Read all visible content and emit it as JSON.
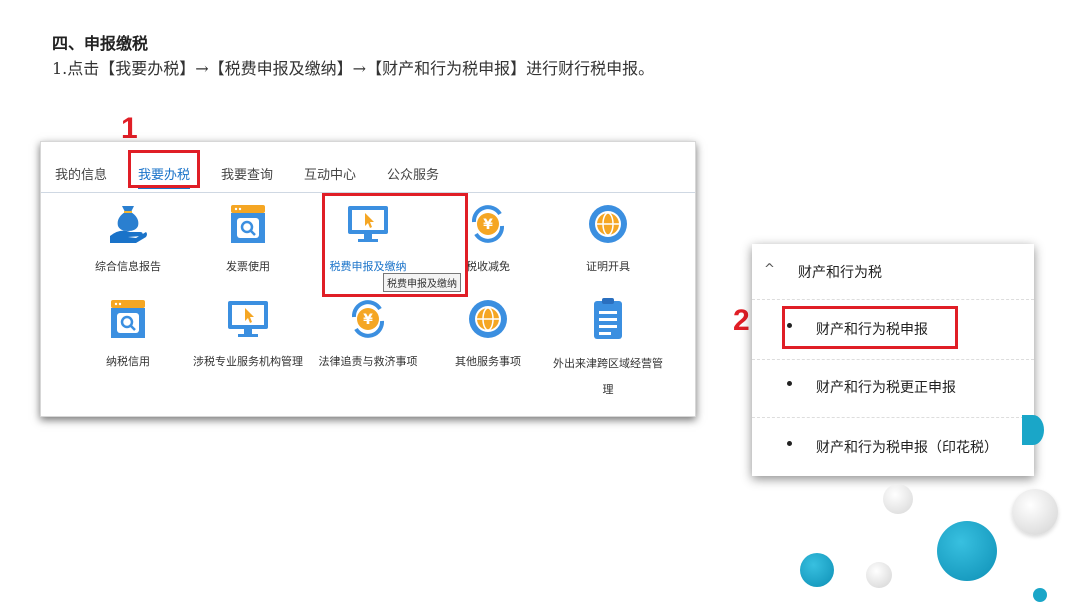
{
  "heading": "四、申报缴税",
  "instruction": "1.点击【我要办税】→【税费申报及缴纳】→【财产和行为税申报】进行财行税申报。",
  "step_numbers": {
    "first": "1",
    "second": "2"
  },
  "tabs": [
    {
      "label": "我的信息"
    },
    {
      "label": "我要办税"
    },
    {
      "label": "我要查询"
    },
    {
      "label": "互动中心"
    },
    {
      "label": "公众服务"
    }
  ],
  "grid": {
    "row1": [
      {
        "label": "综合信息报告",
        "icon": "money-bag-hand-icon"
      },
      {
        "label": "发票使用",
        "icon": "invoice-search-icon"
      },
      {
        "label": "税费申报及缴纳",
        "icon": "monitor-cursor-icon"
      },
      {
        "label": "税收减免",
        "icon": "yuan-cycle-icon"
      },
      {
        "label": "证明开具",
        "icon": "globe-icon"
      }
    ],
    "row2": [
      {
        "label": "纳税信用",
        "icon": "invoice-search-icon"
      },
      {
        "label": "涉税专业服务机构管理",
        "icon": "monitor-cursor-icon"
      },
      {
        "label": "法律追责与救济事项",
        "icon": "yuan-cycle-icon"
      },
      {
        "label": "其他服务事项",
        "icon": "globe-icon"
      },
      {
        "label": "外出来津跨区域经营管理",
        "icon": "clipboard-icon"
      }
    ]
  },
  "tooltip": "税费申报及缴纳",
  "menu": {
    "caret": "^",
    "title": "财产和行为税",
    "items": [
      {
        "label": "财产和行为税申报"
      },
      {
        "label": "财产和行为税更正申报"
      },
      {
        "label": "财产和行为税申报（印花税）"
      }
    ]
  },
  "colors": {
    "accent_red": "#e01e26",
    "link_blue": "#1a73c9",
    "decor_teal": "#1aa6c8"
  }
}
